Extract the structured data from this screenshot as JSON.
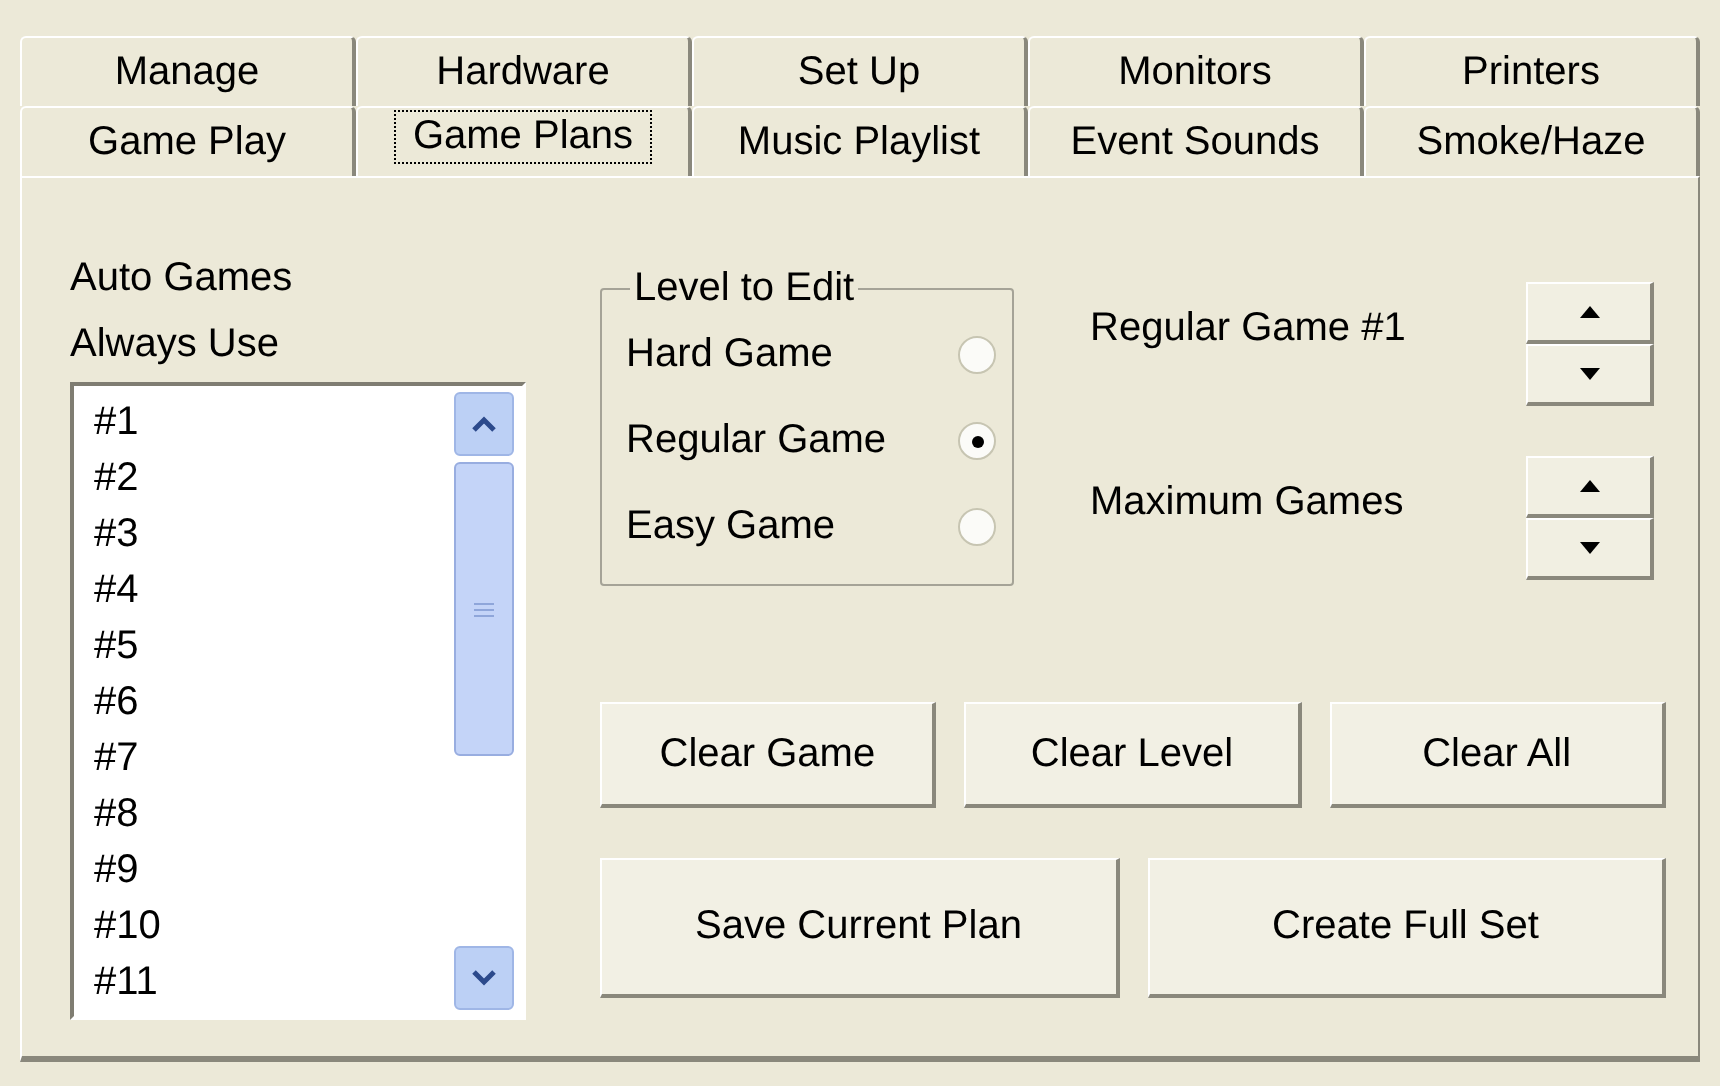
{
  "tab_rows": [
    {
      "tabs": [
        {
          "label": "Manage",
          "selected": false
        },
        {
          "label": "Hardware",
          "selected": false
        },
        {
          "label": "Set Up",
          "selected": false
        },
        {
          "label": "Monitors",
          "selected": false
        },
        {
          "label": "Printers",
          "selected": false
        }
      ]
    },
    {
      "tabs": [
        {
          "label": "Game Play",
          "selected": false
        },
        {
          "label": "Game Plans",
          "selected": true
        },
        {
          "label": "Music Playlist",
          "selected": false
        },
        {
          "label": "Event Sounds",
          "selected": false
        },
        {
          "label": "Smoke/Haze",
          "selected": false
        }
      ]
    }
  ],
  "auto_games": {
    "labels": [
      "Auto Games",
      "Always Use"
    ],
    "items": [
      "#1",
      "#2",
      "#3",
      "#4",
      "#5",
      "#6",
      "#7",
      "#8",
      "#9",
      "#10",
      "#11"
    ]
  },
  "level_to_edit": {
    "title": "Level to Edit",
    "options": [
      {
        "label": "Hard Game",
        "selected": false
      },
      {
        "label": "Regular Game",
        "selected": true
      },
      {
        "label": "Easy Game",
        "selected": false
      }
    ]
  },
  "spinners": [
    {
      "label": "Regular Game #1"
    },
    {
      "label": "Maximum Games"
    }
  ],
  "button_rows": [
    [
      "Clear Game",
      "Clear Level",
      "Clear All"
    ],
    [
      "Save Current Plan",
      "Create Full Set"
    ]
  ]
}
